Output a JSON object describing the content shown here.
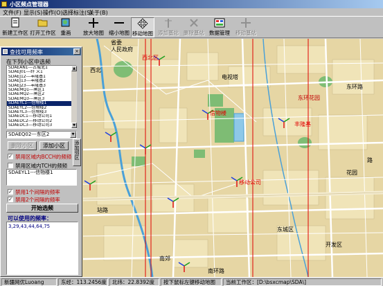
{
  "window": {
    "title": "小区频点管理器"
  },
  "menu": [
    "文件(F)",
    "显示(S)",
    "操作(O)",
    "选择标注(S)",
    "关于(B)"
  ],
  "toolbar": [
    {
      "label": "新建工作区",
      "icon": "new-workspace-icon",
      "disabled": false,
      "active": false
    },
    {
      "label": "打开工作区",
      "icon": "open-folder-icon",
      "disabled": false,
      "active": false
    },
    {
      "label": "重画",
      "icon": "redraw-icon",
      "disabled": false,
      "active": false
    },
    {
      "label": "放大地图",
      "icon": "zoom-in-icon",
      "disabled": false,
      "active": false
    },
    {
      "label": "缩小地图",
      "icon": "zoom-out-icon",
      "disabled": false,
      "active": false
    },
    {
      "label": "移动地图",
      "icon": "pan-icon",
      "disabled": false,
      "active": true
    },
    {
      "label": "添加基站",
      "icon": "add-station-icon",
      "disabled": true,
      "active": false
    },
    {
      "label": "删除基站",
      "icon": "delete-station-icon",
      "disabled": true,
      "active": false
    },
    {
      "label": "数据管理",
      "icon": "data-manage-icon",
      "disabled": false,
      "active": false
    },
    {
      "label": "移动基站",
      "icon": "move-station-icon",
      "disabled": true,
      "active": false
    }
  ],
  "panel": {
    "title": "查找可用频率",
    "select_label": "在下列小区中选频",
    "cells": [
      "SDAEAN1---古城北1",
      "SDAEJ01---纤 义1",
      "SDAEJ12---丰隆基1",
      "SDAEJ13---丰隆基2",
      "SDAEJ23---丰隆基3",
      "SDAEMQ1---闸区1",
      "SDAEMQ2---闸区2",
      "SDAEMQ3---闸区3",
      "SDAEYL1---信物楼1",
      "SDAEYL2---信物楼2",
      "SDAEYL3---信物楼3",
      "SDAEDC1---移动公司1",
      "SDAEDC2---移动公司2",
      "SDAEDC3---移动公司3"
    ],
    "selected_cell": "SDAEYL1---信物楼1",
    "combo_value": "SDAEQ02---东区2",
    "btn_delete": "删除小区",
    "btn_add": "添加小区",
    "check1": "禁用区域内BCCH的频频",
    "check2": "禁用区域内TCH的频频",
    "side_btn": "添加邻区",
    "chosen_list": [
      "SDAEYL1---信物楼1"
    ],
    "check3": "禁用1个间隔的频率",
    "check4": "禁用2个间隔的频率",
    "start_btn": "开始选频",
    "result_label": "可以使用的频率：",
    "result_value": "3,29,43,44,64,75"
  },
  "map": {
    "labels": [
      "电视塔",
      "东环花园",
      "西北区",
      "信物楼",
      "移动公司",
      "丰隆基",
      "东城区",
      "南郊",
      "花园",
      "路",
      "西北",
      "东环路",
      "站路",
      "开发区",
      "南环路",
      "省委",
      "人民政府"
    ]
  },
  "status": {
    "network": "新疆网优Luoang",
    "lon": "东经：113.2456度",
    "lat": "北纬：22.8392度",
    "hint": "按下鼠标左键移动地图",
    "workspace": "当前工作区：[D:\\bsxcmap\\SDA\\]"
  },
  "colors": {
    "title_bar": "#0a246a",
    "face": "#c0c0c0",
    "map_bg": "#e8d8a8",
    "road": "#ffffff",
    "river": "#4aa0d8",
    "red_line": "#e00000",
    "green_area": "#6cb86c"
  }
}
